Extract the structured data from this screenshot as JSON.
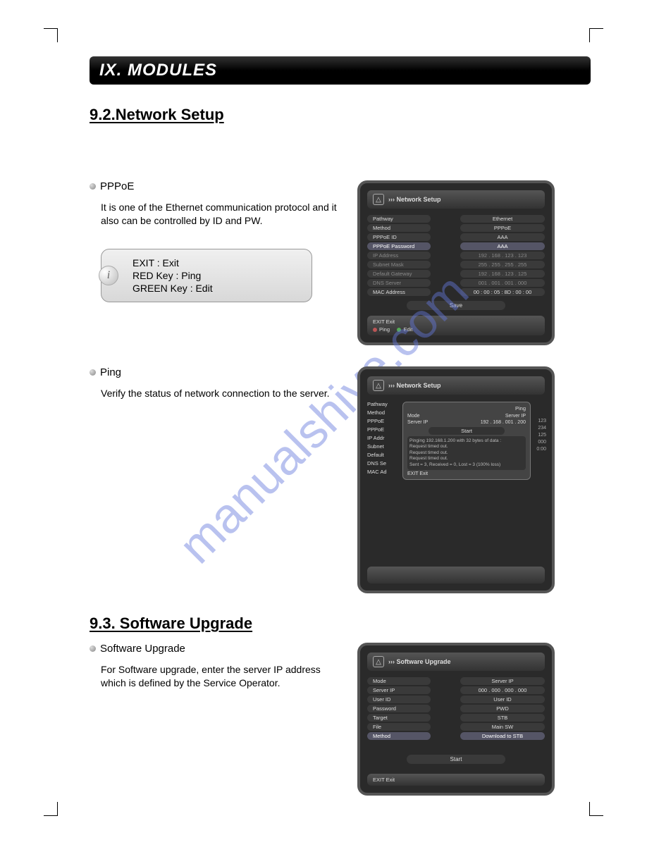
{
  "chapter": "IX. MODULES",
  "section92": "9.2.Network Setup",
  "section93": "9.3. Software Upgrade",
  "watermark": "manualshive.com",
  "pppoe": {
    "heading": "PPPoE",
    "body": "It is one of the Ethernet communication protocol and it also can be controlled by ID and PW.",
    "info_line1": "EXIT : Exit",
    "info_line2": "RED Key : Ping",
    "info_line3": "GREEN Key : Edit"
  },
  "ping": {
    "heading": "Ping",
    "body": "Verify the status of network connection to the server."
  },
  "swup": {
    "heading": "Software Upgrade",
    "body": "For Software upgrade, enter the server IP address which is defined by the Service Operator."
  },
  "dev_network": {
    "title": "››› Network Setup",
    "rows": [
      {
        "lbl": "Pathway",
        "val": "Ethernet"
      },
      {
        "lbl": "Method",
        "val": "PPPoE"
      },
      {
        "lbl": "PPPoE ID",
        "val": "AAA"
      },
      {
        "lbl": "PPPoE Password",
        "val": "AAA",
        "hl": true
      },
      {
        "lbl": "IP Address",
        "val": "192 . 168 . 123 . 123",
        "dim": true
      },
      {
        "lbl": "Subnet Mask",
        "val": "255 . 255 . 255 . 255",
        "dim": true
      },
      {
        "lbl": "Default Gateway",
        "val": "192 . 168 . 123 . 125",
        "dim": true
      },
      {
        "lbl": "DNS Server",
        "val": "001 . 001 . 001 . 000",
        "dim": true
      },
      {
        "lbl": "MAC Address",
        "val": "00 : 00 : 05 : 8D : 00 : 00"
      }
    ],
    "save": "Save",
    "footer_exit": "EXIT  Exit",
    "footer_ping": "Ping",
    "footer_edit": "Edit"
  },
  "dev_ping": {
    "title": "››› Network Setup",
    "left_labels": [
      "Pathway",
      "Method",
      "PPPoE",
      "PPPoE",
      "IP Addr",
      "Subnet",
      "Default",
      "DNS Se",
      "MAC Ad"
    ],
    "side_vals": [
      "",
      "",
      "",
      "",
      "123",
      "234",
      "125",
      "000",
      "0:00"
    ],
    "dialog_title": "Ping",
    "mode_lbl": "Mode",
    "mode_val": "Server IP",
    "serverip_lbl": "Server IP",
    "serverip_val": "192 . 168 . 001 . 200",
    "start": "Start",
    "log_l1": "Pinging 192.168.1.200 with 32 bytes of data :",
    "log_l2": "Request timed out.",
    "log_l3": "Request timed out.",
    "log_l4": "Request timed out.",
    "log_l5": "Sent = 3, Received = 0, Lost = 3 (100% loss)",
    "exit": "EXIT  Exit"
  },
  "dev_swup": {
    "title": "››› Software Upgrade",
    "rows": [
      {
        "lbl": "Mode",
        "val": "Server IP"
      },
      {
        "lbl": "Server IP",
        "val": "000 . 000 . 000 . 000"
      },
      {
        "lbl": "User ID",
        "val": "User ID"
      },
      {
        "lbl": "Password",
        "val": "PWD"
      },
      {
        "lbl": "Target",
        "val": "STB"
      },
      {
        "lbl": "File",
        "val": "Main SW"
      },
      {
        "lbl": "Method",
        "val": "Download to STB",
        "hl": true
      }
    ],
    "start": "Start",
    "footer_exit": "EXIT  Exit"
  }
}
